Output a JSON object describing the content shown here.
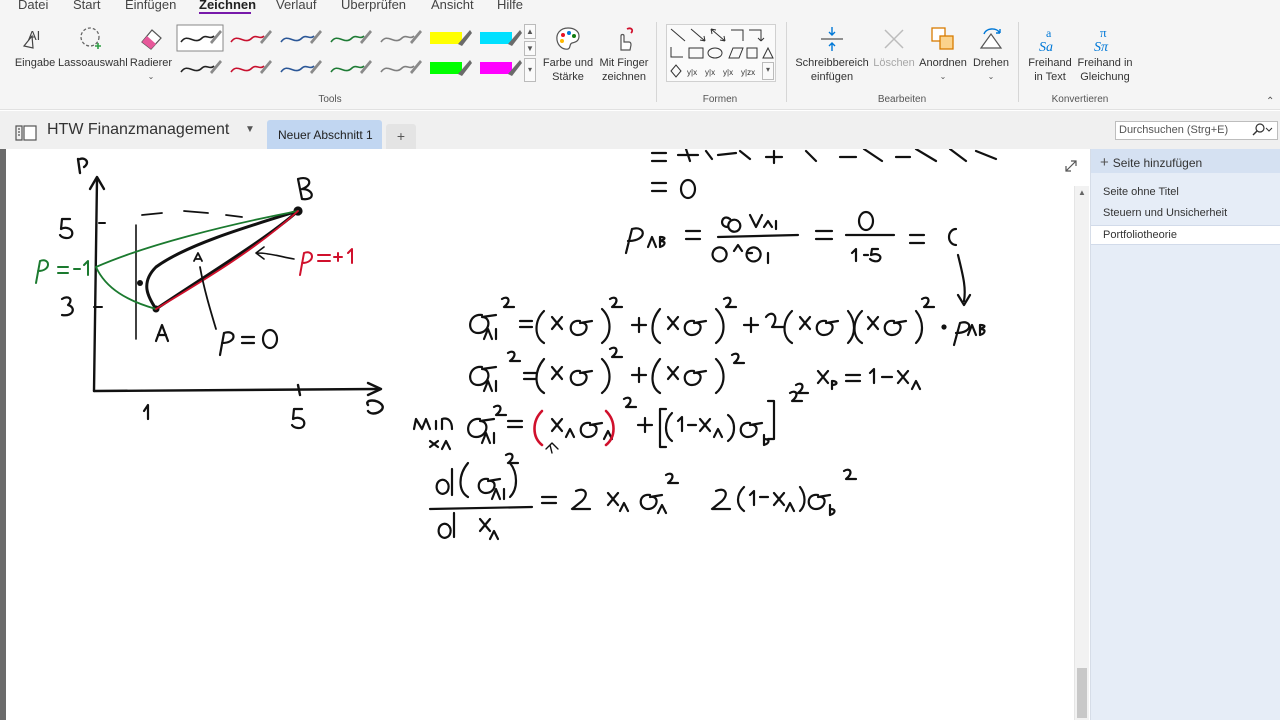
{
  "menu": {
    "items": [
      "Datei",
      "Start",
      "Einfügen",
      "Zeichnen",
      "Verlauf",
      "Überprüfen",
      "Ansicht",
      "Hilfe"
    ],
    "active_index": 3,
    "accent_color": "#7719aa"
  },
  "ribbon": {
    "tools": {
      "eingabe": "Eingabe",
      "lasso": "Lassoauswahl",
      "radierer": "Radierer",
      "label": "Tools"
    },
    "pens": [
      {
        "color": "#222222",
        "kind": "pen"
      },
      {
        "color": "#c8102e",
        "kind": "pen"
      },
      {
        "color": "#2b5797",
        "kind": "pen"
      },
      {
        "color": "#1e7b35",
        "kind": "pen"
      },
      {
        "color": "#7f7f7f",
        "kind": "pen"
      },
      {
        "color": "#ffff00",
        "kind": "highlighter"
      },
      {
        "color": "#00e0ff",
        "kind": "highlighter"
      },
      {
        "color": "#222222",
        "kind": "pen"
      },
      {
        "color": "#c8102e",
        "kind": "pen"
      },
      {
        "color": "#2b5797",
        "kind": "pen"
      },
      {
        "color": "#1e7b35",
        "kind": "pen"
      },
      {
        "color": "#7f7f7f",
        "kind": "pen"
      },
      {
        "color": "#00ff00",
        "kind": "highlighter"
      },
      {
        "color": "#ff00ff",
        "kind": "highlighter"
      }
    ],
    "farbe_line1": "Farbe und",
    "farbe_line2": "Stärke",
    "finger_line1": "Mit Finger",
    "finger_line2": "zeichnen",
    "formen_label": "Formen",
    "schreib_line1": "Schreibbereich",
    "schreib_line2": "einfügen",
    "loeschen": "Löschen",
    "anordnen": "Anordnen",
    "drehen": "Drehen",
    "bearbeiten_label": "Bearbeiten",
    "freihand_text_line1": "Freihand",
    "freihand_text_line2": "in Text",
    "freihand_gl_line1": "Freihand in",
    "freihand_gl_line2": "Gleichung",
    "konvertieren_label": "Konvertieren"
  },
  "notebook": {
    "title": "HTW Finanzmanagement",
    "section_tab": "Neuer Abschnitt 1",
    "add_tab": "+",
    "search_placeholder": "Durchsuchen (Strg+E)"
  },
  "pages": {
    "add_label": "Seite hinzufügen",
    "items": [
      "Seite ohne Titel",
      "Steuern und Unsicherheit",
      "Portfoliotheorie"
    ],
    "active_index": 2
  },
  "ink": {
    "stroke_black": "#111111",
    "stroke_red": "#d0102c",
    "stroke_green": "#1b7a2f"
  }
}
